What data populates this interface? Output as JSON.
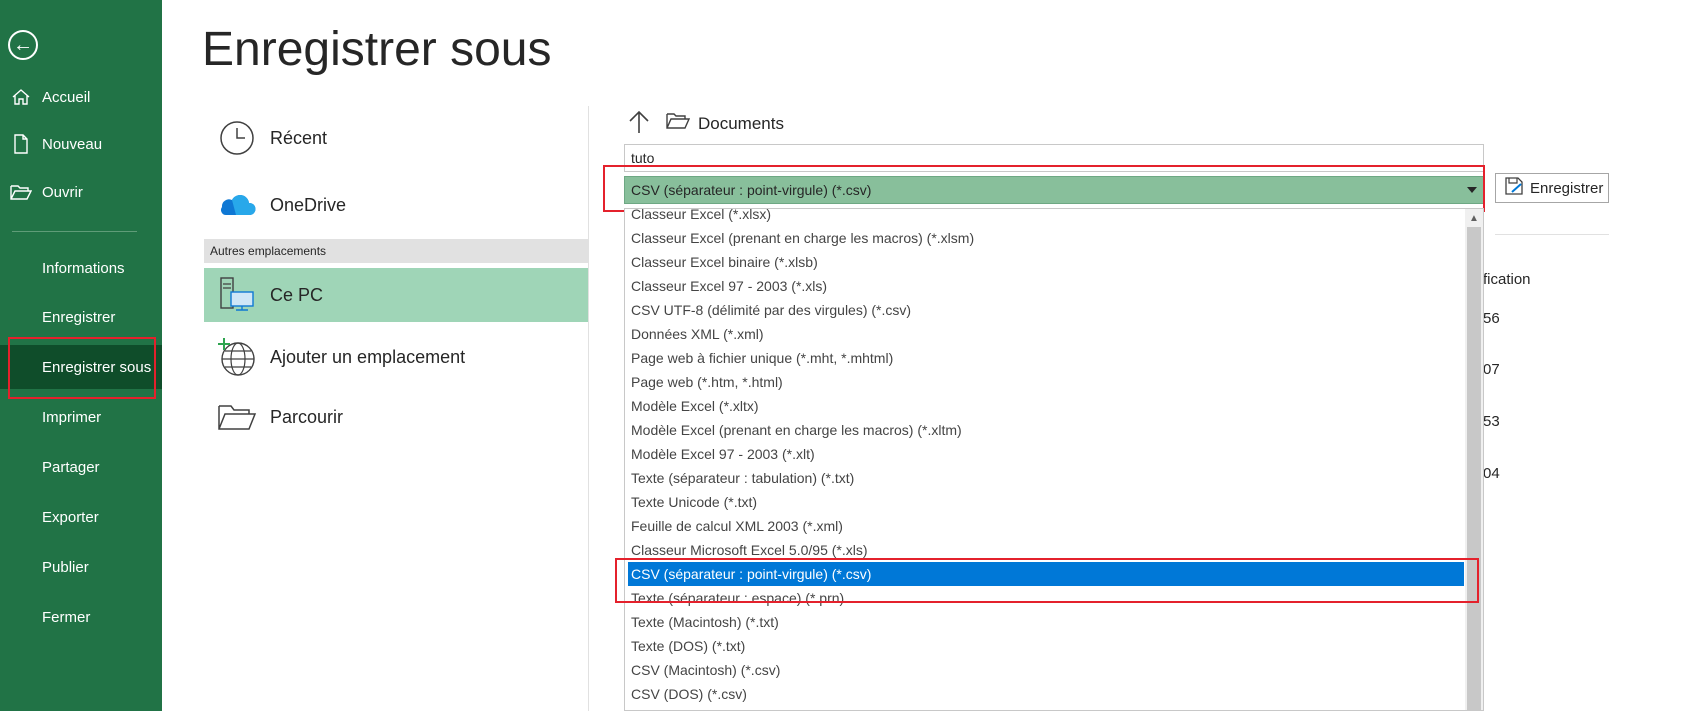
{
  "sidebar": {
    "back_label": "←",
    "items": [
      {
        "label": "Accueil",
        "icon": "home-icon"
      },
      {
        "label": "Nouveau",
        "icon": "new-doc-icon"
      },
      {
        "label": "Ouvrir",
        "icon": "open-folder-icon"
      },
      {
        "label": "Informations"
      },
      {
        "label": "Enregistrer"
      },
      {
        "label": "Enregistrer sous",
        "active": true
      },
      {
        "label": "Imprimer"
      },
      {
        "label": "Partager"
      },
      {
        "label": "Exporter"
      },
      {
        "label": "Publier"
      },
      {
        "label": "Fermer"
      }
    ]
  },
  "page": {
    "title": "Enregistrer sous"
  },
  "locations": {
    "recent": "Récent",
    "onedrive": "OneDrive",
    "other_header": "Autres emplacements",
    "this_pc": "Ce PC",
    "add_location": "Ajouter un emplacement",
    "browse": "Parcourir"
  },
  "file_pane": {
    "current_folder": "Documents",
    "filename_value": "tuto",
    "selected_type": "CSV (séparateur : point-virgule) (*.csv)",
    "save_label": "Enregistrer",
    "column_partial": "fication",
    "time_partials": [
      "56",
      "07",
      "53",
      "04"
    ]
  },
  "file_types": [
    "Classeur Excel (*.xlsx)",
    "Classeur Excel (prenant en charge les macros) (*.xlsm)",
    "Classeur Excel binaire (*.xlsb)",
    "Classeur Excel 97 - 2003 (*.xls)",
    "CSV UTF-8 (délimité par des virgules) (*.csv)",
    "Données XML (*.xml)",
    "Page web à fichier unique (*.mht, *.mhtml)",
    "Page web (*.htm, *.html)",
    "Modèle Excel (*.xltx)",
    "Modèle Excel (prenant en charge les macros) (*.xltm)",
    "Modèle Excel 97 - 2003 (*.xlt)",
    "Texte (séparateur : tabulation) (*.txt)",
    "Texte Unicode (*.txt)",
    "Feuille de calcul XML 2003 (*.xml)",
    "Classeur Microsoft Excel 5.0/95 (*.xls)",
    "CSV (séparateur : point-virgule) (*.csv)",
    "Texte (séparateur : espace) (*.prn)",
    "Texte (Macintosh) (*.txt)",
    "Texte (DOS) (*.txt)",
    "CSV (Macintosh) (*.csv)",
    "CSV (DOS) (*.csv)"
  ],
  "colors": {
    "sidebar_bg": "#217346",
    "sidebar_active": "#0f4d2a",
    "location_selected": "#9fd5b7",
    "select_bg": "#88bf9b",
    "option_selected": "#0078d7",
    "highlight_box": "#e4212c"
  }
}
